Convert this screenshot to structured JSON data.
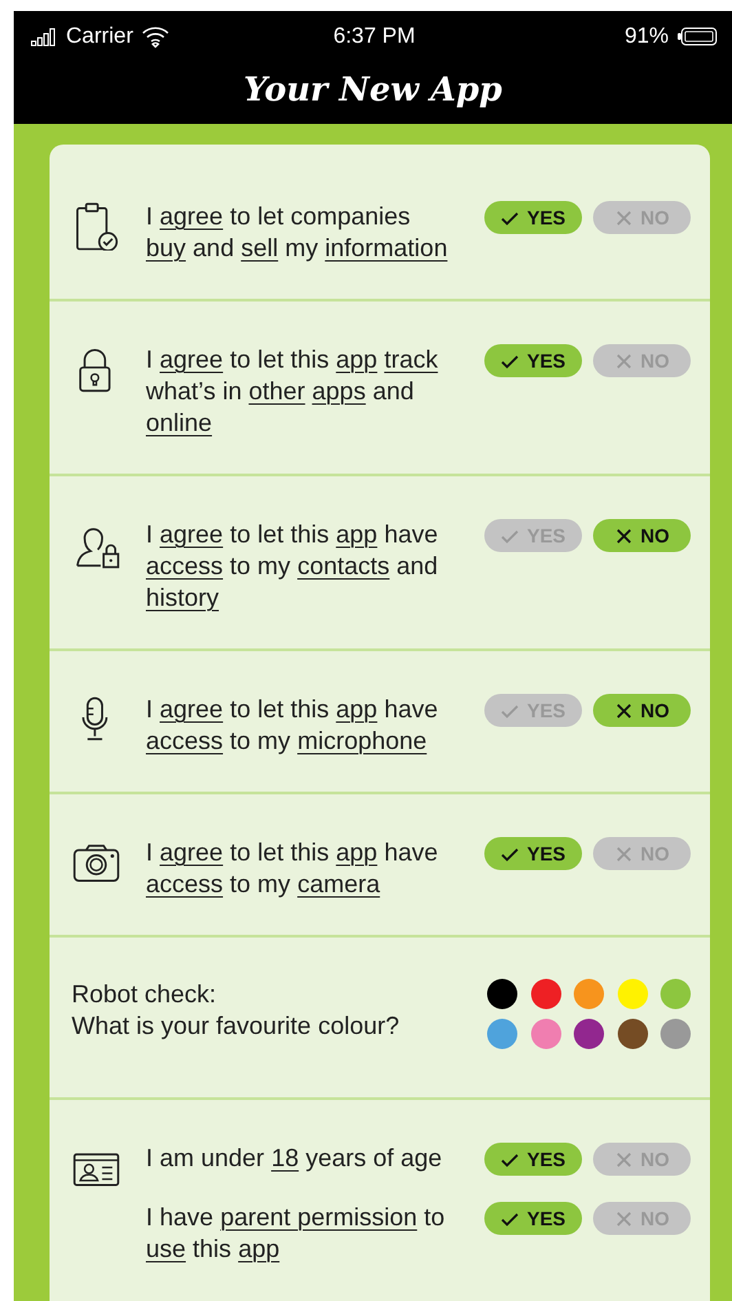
{
  "status_bar": {
    "carrier": "Carrier",
    "time": "6:37 PM",
    "battery": "91%"
  },
  "header": {
    "title": "Your New App"
  },
  "rows": [
    {
      "kind": "consent",
      "statements": [
        {
          "parts": [
            {
              "text": "I",
              "underlined": false
            },
            {
              "text": "agree",
              "underlined": true
            },
            {
              "text": "to let companies",
              "underlined": false
            },
            {
              "text": "buy",
              "underlined": true
            },
            {
              "text": "and",
              "underlined": false
            },
            {
              "text": "sell",
              "underlined": true
            },
            {
              "text": "my",
              "underlined": false
            },
            {
              "text": "information",
              "underlined": true
            }
          ],
          "buttons": [
            {
              "label": "YES",
              "kind": "yes",
              "selected": true
            },
            {
              "label": "NO",
              "kind": "no",
              "selected": false
            }
          ]
        }
      ]
    },
    {
      "kind": "consent",
      "statements": [
        {
          "parts": [
            {
              "text": "I",
              "underlined": false
            },
            {
              "text": "agree",
              "underlined": true
            },
            {
              "text": "to let this",
              "underlined": false
            },
            {
              "text": "app",
              "underlined": true
            },
            {
              "text": "track",
              "underlined": true
            },
            {
              "text": "what’s in",
              "underlined": false
            },
            {
              "text": "other",
              "underlined": true
            },
            {
              "text": "apps",
              "underlined": true
            },
            {
              "text": "and",
              "underlined": false
            },
            {
              "text": "online",
              "underlined": true
            }
          ],
          "buttons": [
            {
              "label": "YES",
              "kind": "yes",
              "selected": true
            },
            {
              "label": "NO",
              "kind": "no",
              "selected": false
            }
          ]
        }
      ]
    },
    {
      "kind": "consent",
      "statements": [
        {
          "parts": [
            {
              "text": "I",
              "underlined": false
            },
            {
              "text": "agree",
              "underlined": true
            },
            {
              "text": "to let this",
              "underlined": false
            },
            {
              "text": "app",
              "underlined": true
            },
            {
              "text": "have",
              "underlined": false
            },
            {
              "text": "access",
              "underlined": true
            },
            {
              "text": "to my",
              "underlined": false
            },
            {
              "text": "contacts",
              "underlined": true
            },
            {
              "text": "and",
              "underlined": false
            },
            {
              "text": "history",
              "underlined": true
            }
          ],
          "buttons": [
            {
              "label": "YES",
              "kind": "yes",
              "selected": false
            },
            {
              "label": "NO",
              "kind": "no",
              "selected": true
            }
          ]
        }
      ]
    },
    {
      "kind": "consent",
      "statements": [
        {
          "parts": [
            {
              "text": "I",
              "underlined": false
            },
            {
              "text": "agree",
              "underlined": true
            },
            {
              "text": "to let this",
              "underlined": false
            },
            {
              "text": "app",
              "underlined": true
            },
            {
              "text": "have",
              "underlined": false
            },
            {
              "text": "access",
              "underlined": true
            },
            {
              "text": "to my",
              "underlined": false
            },
            {
              "text": "microphone",
              "underlined": true
            }
          ],
          "buttons": [
            {
              "label": "YES",
              "kind": "yes",
              "selected": false
            },
            {
              "label": "NO",
              "kind": "no",
              "selected": true
            }
          ]
        }
      ]
    },
    {
      "kind": "consent",
      "statements": [
        {
          "parts": [
            {
              "text": "I",
              "underlined": false
            },
            {
              "text": "agree",
              "underlined": true
            },
            {
              "text": "to let this",
              "underlined": false
            },
            {
              "text": "app",
              "underlined": true
            },
            {
              "text": "have",
              "underlined": false
            },
            {
              "text": "access",
              "underlined": true
            },
            {
              "text": "to my",
              "underlined": false
            },
            {
              "text": "camera",
              "underlined": true
            }
          ],
          "buttons": [
            {
              "label": "YES",
              "kind": "yes",
              "selected": true
            },
            {
              "label": "NO",
              "kind": "no",
              "selected": false
            }
          ]
        }
      ]
    },
    {
      "kind": "robot_check",
      "question_lines": [
        "Robot check:",
        "What is your favourite colour?"
      ],
      "colors": [
        {
          "color": "#000000"
        },
        {
          "color": "#ee2024"
        },
        {
          "color": "#f7941d"
        },
        {
          "color": "#fff200"
        },
        {
          "color": "#8dc63f"
        },
        {
          "color": "#4fa3dc"
        },
        {
          "color": "#f07eb0"
        },
        {
          "color": "#92278f"
        },
        {
          "color": "#754c24"
        },
        {
          "color": "#999999"
        }
      ]
    },
    {
      "kind": "consent",
      "statements": [
        {
          "parts": [
            {
              "text": "I am under",
              "underlined": false
            },
            {
              "text": "18",
              "underlined": true
            },
            {
              "text": "years of age",
              "underlined": false
            }
          ],
          "buttons": [
            {
              "label": "YES",
              "kind": "yes",
              "selected": true
            },
            {
              "label": "NO",
              "kind": "no",
              "selected": false
            }
          ]
        },
        {
          "parts": [
            {
              "text": "I have",
              "underlined": false
            },
            {
              "text": "parent permission",
              "underlined": true
            },
            {
              "text": "to",
              "underlined": false
            },
            {
              "text": "use",
              "underlined": true
            },
            {
              "text": "this",
              "underlined": false
            },
            {
              "text": "app",
              "underlined": true
            }
          ],
          "buttons": [
            {
              "label": "YES",
              "kind": "yes",
              "selected": true
            },
            {
              "label": "NO",
              "kind": "no",
              "selected": false
            }
          ]
        }
      ]
    }
  ]
}
